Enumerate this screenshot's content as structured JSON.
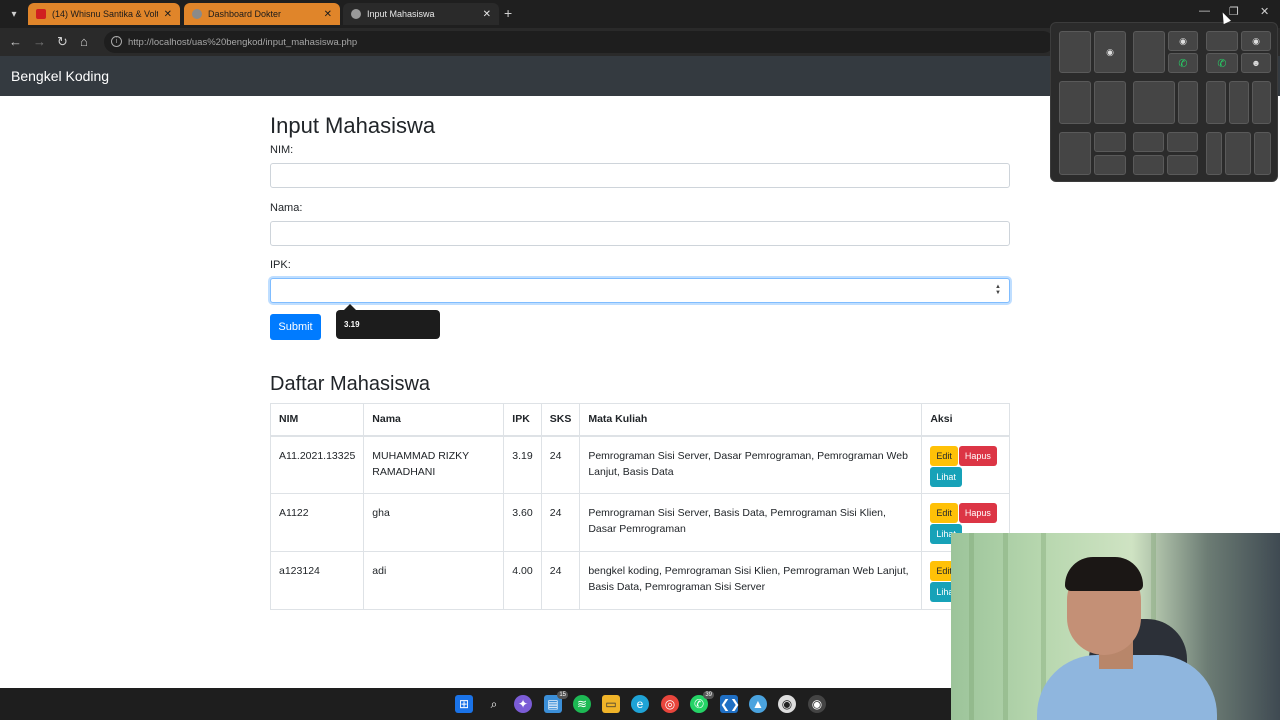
{
  "browser": {
    "tabs": [
      {
        "title": "(14) Whisnu Santika & Volt - Sa",
        "active": false
      },
      {
        "title": "Dashboard Dokter",
        "active": false
      },
      {
        "title": "Input Mahasiswa",
        "active": true
      }
    ],
    "url": "http://localhost/uas%20bengkod/input_mahasiswa.php",
    "icons": [
      "tab-search-icon",
      "back-icon",
      "forward-icon",
      "reload-icon",
      "home-icon",
      "info-icon",
      "new-tab-icon",
      "minimize-icon",
      "restore-icon",
      "close-icon"
    ]
  },
  "navbar": {
    "brand": "Bengkel Koding"
  },
  "form": {
    "title": "Input Mahasiswa",
    "nim_label": "NIM:",
    "nama_label": "Nama:",
    "ipk_label": "IPK:",
    "nim_value": "",
    "nama_value": "",
    "ipk_value": "",
    "submit_label": "Submit",
    "tooltip_value": "3.19"
  },
  "list": {
    "title": "Daftar Mahasiswa",
    "headers": [
      "NIM",
      "Nama",
      "IPK",
      "SKS",
      "Mata Kuliah",
      "Aksi"
    ],
    "rows": [
      {
        "nim": "A11.2021.13325",
        "nama": "MUHAMMAD RIZKY RAMADHANI",
        "ipk": "3.19",
        "sks": "24",
        "mk": "Pemrograman Sisi Server, Dasar Pemrograman, Pemrograman Web Lanjut, Basis Data",
        "actions": [
          "Edit",
          "Hapus",
          "Lihat"
        ]
      },
      {
        "nim": "A1122",
        "nama": "gha",
        "ipk": "3.60",
        "sks": "24",
        "mk": "Pemrograman Sisi Server, Basis Data, Pemrograman Sisi Klien, Dasar Pemrograman",
        "actions": [
          "Edit",
          "Hapus",
          "Lihat"
        ]
      },
      {
        "nim": "a123124",
        "nama": "adi",
        "ipk": "4.00",
        "sks": "24",
        "mk": "bengkel koding, Pemrograman Sisi Klien, Pemrograman Web Lanjut, Basis Data, Pemrograman Sisi Server",
        "actions": [
          "Edit",
          "Lihat"
        ]
      }
    ]
  },
  "taskbar": {
    "icons": [
      "windows-start-icon",
      "search-icon",
      "copilot-icon",
      "task-view-icon",
      "spotify-icon",
      "file-explorer-icon",
      "edge-icon",
      "chrome-icon",
      "whatsapp-icon",
      "vscode-icon",
      "app-icon",
      "obs-icon",
      "obs-icon-2"
    ],
    "badges": {
      "task_view": "15",
      "whatsapp": "39"
    }
  },
  "colors": {
    "primary": "#007bff",
    "warning": "#ffc107",
    "danger": "#dc3545",
    "info": "#17a2b8",
    "navbar": "#343a40"
  }
}
